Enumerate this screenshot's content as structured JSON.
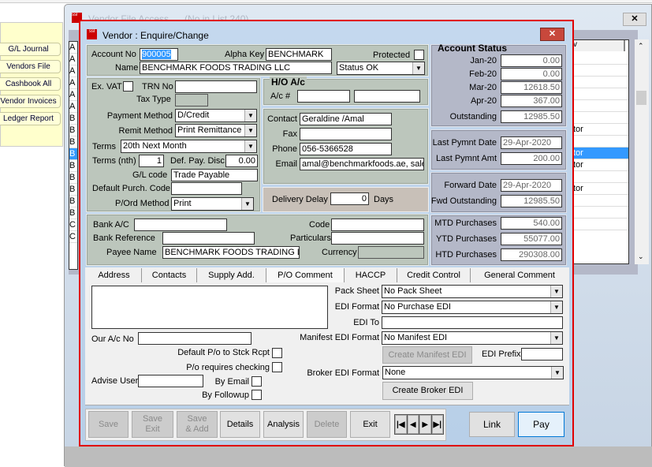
{
  "left_menu": {
    "items": [
      "G/L Journal",
      "Vendors File",
      "Cashbook All",
      "Vendor Invoices",
      "Ledger Report"
    ]
  },
  "bg_window": {
    "title": "Vendor File Access      (No in List 240)",
    "list_left": [
      "A",
      "A",
      "A",
      "A",
      "A",
      "A",
      "B",
      "B",
      "B",
      "B",
      "B",
      "B",
      "B",
      "B",
      "B",
      "C",
      "C"
    ],
    "list_right": [
      "",
      "",
      "",
      "",
      "",
      "",
      "tor",
      "",
      "tor",
      "tor",
      "",
      "tor",
      "",
      "",
      "",
      "",
      ""
    ],
    "header_col": "v"
  },
  "dialog": {
    "title": "Vendor : Enquire/Change",
    "account_no_label": "Account No",
    "account_no": "900005",
    "alpha_key_label": "Alpha Key",
    "alpha_key": "BENCHMARK",
    "protected_label": "Protected",
    "name_label": "Name",
    "name": "BENCHMARK FOODS TRADING LLC",
    "status": "Status OK",
    "ex_vat_label": "Ex. VAT",
    "trn_label": "TRN No",
    "trn": "",
    "tax_type_label": "Tax Type",
    "payment_method_label": "Payment Method",
    "payment_method": "D/Credit",
    "remit_method_label": "Remit Method",
    "remit_method": "Print Remittance",
    "terms_label": "Terms",
    "terms": "20th Next Month",
    "terms_nth_label": "Terms (nth)",
    "terms_nth": "1",
    "def_pay_disc_label": "Def. Pay. Disc.",
    "def_pay_disc": "0.00",
    "gl_code_label": "G/L code",
    "gl_code": "Trade Payable",
    "default_purch_label": "Default Purch. Code",
    "pord_method_label": "P/Ord Method",
    "pord_method": "Print",
    "ho_title": "H/O A/c",
    "ho_ac_label": "A/c #",
    "contact_label": "Contact",
    "contact": "Geraldine /Amal",
    "fax_label": "Fax",
    "phone_label": "Phone",
    "phone": "056-5366528",
    "email_label": "Email",
    "email": "amal@benchmarkfoods.ae, sales",
    "delivery_delay_label": "Delivery Delay",
    "delivery_delay": "0",
    "days_label": "Days",
    "bank_ac_label": "Bank A/C",
    "code_label": "Code",
    "bank_ref_label": "Bank Reference",
    "particulars_label": "Particulars",
    "payee_name_label": "Payee Name",
    "payee_name": "BENCHMARK FOODS TRADING L",
    "currency_label": "Currency"
  },
  "account_status": {
    "title": "Account Status",
    "months": [
      {
        "label": "Jan-20",
        "value": "0.00"
      },
      {
        "label": "Feb-20",
        "value": "0.00"
      },
      {
        "label": "Mar-20",
        "value": "12618.50"
      },
      {
        "label": "Apr-20",
        "value": "367.00"
      }
    ],
    "outstanding_label": "Outstanding",
    "outstanding": "12985.50",
    "last_pymnt_date_label": "Last Pymnt Date",
    "last_pymnt_date": "29-Apr-2020",
    "last_pymnt_amt_label": "Last Pymnt Amt",
    "last_pymnt_amt": "200.00",
    "forward_date_label": "Forward Date",
    "forward_date": "29-Apr-2020",
    "fwd_outstanding_label": "Fwd Outstanding",
    "fwd_outstanding": "12985.50",
    "mtd_label": "MTD Purchases",
    "mtd": "540.00",
    "ytd_label": "YTD Purchases",
    "ytd": "55077.00",
    "htd_label": "HTD Purchases",
    "htd": "290308.00"
  },
  "tabs": [
    "Address",
    "Contacts",
    "Supply Add.",
    "P/O Comment",
    "HACCP",
    "Credit Control",
    "General Comment"
  ],
  "po_tab": {
    "our_ac_label": "Our A/c No",
    "default_po_label": "Default P/o to Stck Rcpt",
    "po_check_label": "P/o requires checking",
    "advise_user_label": "Advise User",
    "by_email_label": "By Email",
    "by_followup_label": "By Followup",
    "pack_sheet_label": "Pack Sheet",
    "pack_sheet": "No Pack Sheet",
    "edi_format_label": "EDI Format",
    "edi_format": "No Purchase EDI",
    "edi_to_label": "EDI To",
    "manifest_label": "Manifest EDI Format",
    "manifest": "No Manifest EDI",
    "create_manifest": "Create Manifest EDI",
    "edi_prefix_label": "EDI Prefix",
    "broker_label": "Broker EDI Format",
    "broker": "None",
    "create_broker": "Create Broker EDI"
  },
  "toolbar": {
    "save": "Save",
    "save_exit_1": "Save",
    "save_exit_2": "Exit",
    "save_add_1": "Save",
    "save_add_2": "& Add",
    "details": "Details",
    "analysis": "Analysis",
    "delete": "Delete",
    "exit": "Exit",
    "link": "Link",
    "pay": "Pay"
  },
  "colors": {
    "dialog_border": "#e00000",
    "panel": "#bcc6bc",
    "status_panel": "#b4b8c8",
    "selection": "#3399ff"
  }
}
